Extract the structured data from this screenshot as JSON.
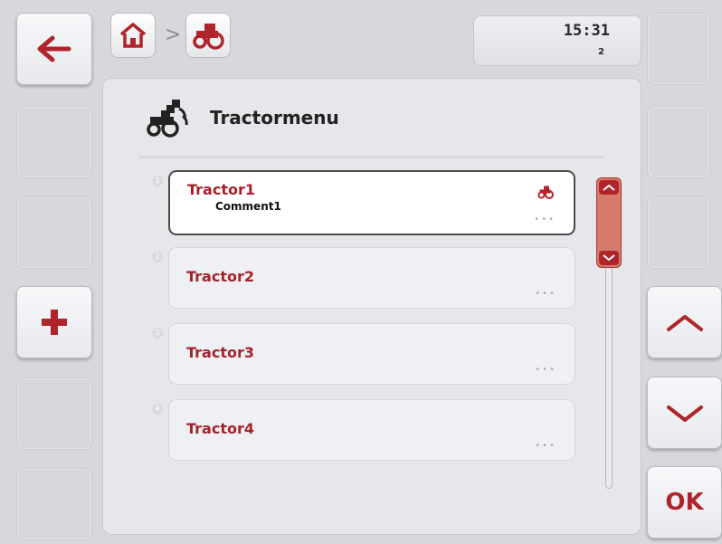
{
  "header": {
    "time": "15:31",
    "page_number": "2",
    "breadcrumb_separator": ">"
  },
  "panel": {
    "title": "Tractormenu"
  },
  "items": [
    {
      "index": "1",
      "name": "Tractor1",
      "comment": "Comment1",
      "more": "•••",
      "selected": true
    },
    {
      "index": "2",
      "name": "Tractor2",
      "comment": "",
      "more": "•••",
      "selected": false
    },
    {
      "index": "3",
      "name": "Tractor3",
      "comment": "",
      "more": "•••",
      "selected": false
    },
    {
      "index": "4",
      "name": "Tractor4",
      "comment": "",
      "more": "•••",
      "selected": false
    }
  ],
  "softkeys": {
    "ok_label": "OK"
  },
  "colors": {
    "accent": "#b0252b",
    "item_text": "#a8202a",
    "scroll_thumb": "#d67a6e"
  },
  "icons": [
    "back-arrow-icon",
    "home-icon",
    "tractor-icon",
    "tractors-group-icon",
    "plus-icon",
    "chevron-up-icon",
    "chevron-down-icon"
  ]
}
